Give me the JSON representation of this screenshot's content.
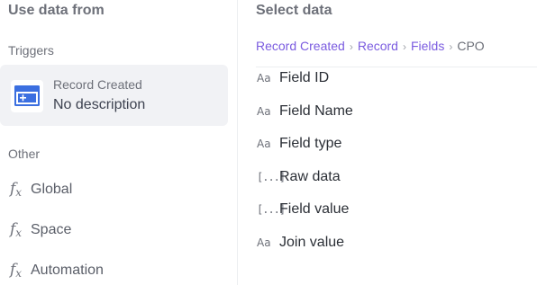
{
  "left_panel": {
    "title": "Use data from",
    "triggers_label": "Triggers",
    "trigger": {
      "title": "Record Created",
      "description": "No description",
      "icon": "record-form-icon"
    },
    "other_label": "Other",
    "other_items": [
      {
        "label": "Global",
        "icon": "function-icon"
      },
      {
        "label": "Space",
        "icon": "function-icon"
      },
      {
        "label": "Automation",
        "icon": "function-icon"
      }
    ]
  },
  "right_panel": {
    "title": "Select data",
    "breadcrumb": [
      {
        "label": "Record Created"
      },
      {
        "label": "Record"
      },
      {
        "label": "Fields"
      },
      {
        "label": "CPO"
      }
    ],
    "fields": [
      {
        "label": "Field ID",
        "icon": "text-type-icon",
        "icon_text": "Aa"
      },
      {
        "label": "Field Name",
        "icon": "text-type-icon",
        "icon_text": "Aa"
      },
      {
        "label": "Field type",
        "icon": "text-type-icon",
        "icon_text": "Aa"
      },
      {
        "label": "Raw data",
        "icon": "object-type-icon",
        "icon_text": "[...]"
      },
      {
        "label": "Field value",
        "icon": "object-type-icon",
        "icon_text": "[...]"
      },
      {
        "label": "Join value",
        "icon": "text-type-icon",
        "icon_text": "Aa"
      }
    ]
  },
  "colors": {
    "accent": "#7b5ce0",
    "icon_blue": "#3b6fe0",
    "selected_bg": "#f1f2f5"
  }
}
